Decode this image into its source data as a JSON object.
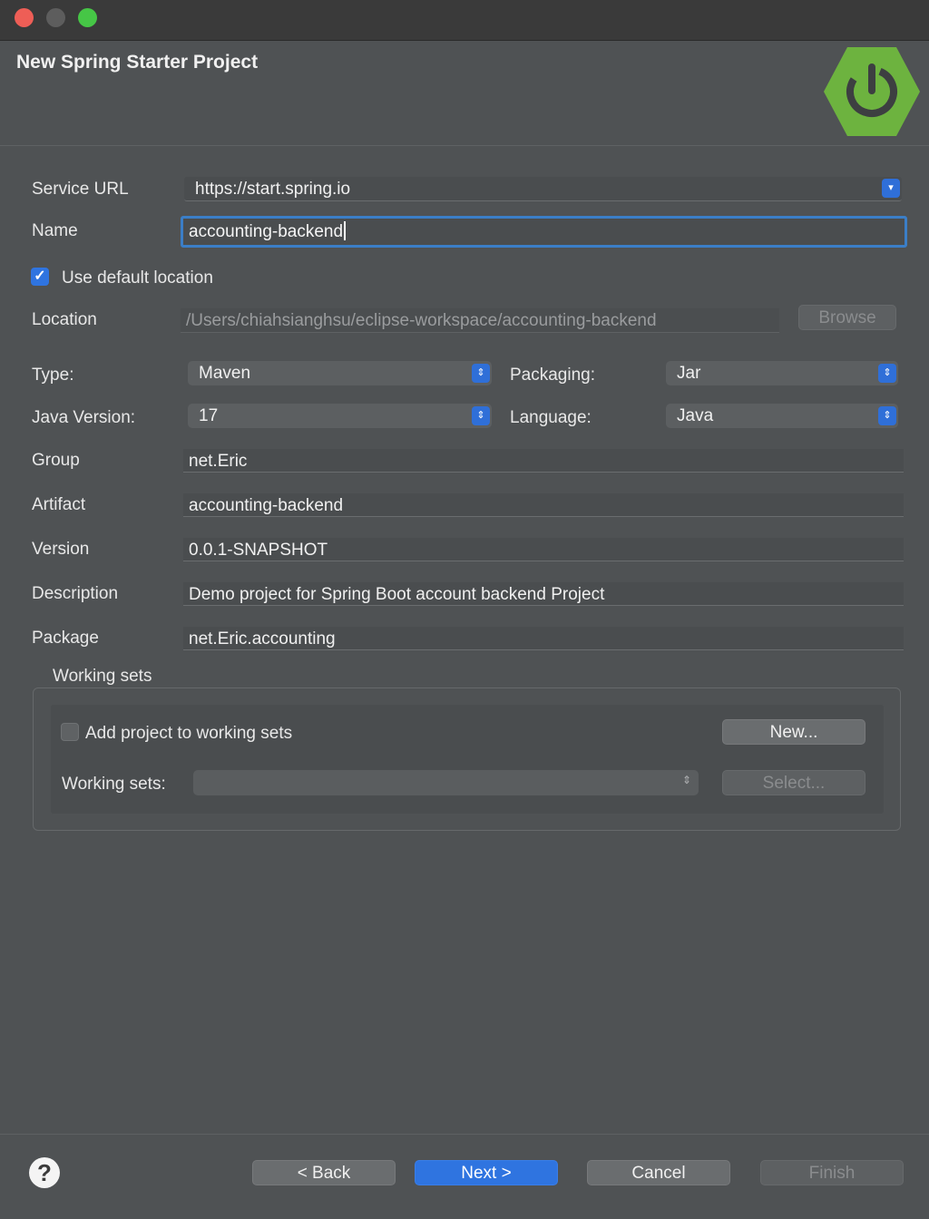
{
  "window": {
    "title": "New Spring Starter Project"
  },
  "form": {
    "service_url": {
      "label": "Service URL",
      "value": "https://start.spring.io"
    },
    "name": {
      "label": "Name",
      "value": "accounting-backend"
    },
    "use_default_location": {
      "label": "Use default location",
      "checked": true
    },
    "location": {
      "label": "Location",
      "value": "/Users/chiahsianghsu/eclipse-workspace/accounting-backend",
      "browse_label": "Browse"
    },
    "type": {
      "label": "Type:",
      "value": "Maven"
    },
    "packaging": {
      "label": "Packaging:",
      "value": "Jar"
    },
    "java_version": {
      "label": "Java Version:",
      "value": "17"
    },
    "language": {
      "label": "Language:",
      "value": "Java"
    },
    "group": {
      "label": "Group",
      "value": "net.Eric"
    },
    "artifact": {
      "label": "Artifact",
      "value": "accounting-backend"
    },
    "version": {
      "label": "Version",
      "value": "0.0.1-SNAPSHOT"
    },
    "description": {
      "label": "Description",
      "value": "Demo project for Spring Boot account backend Project"
    },
    "package": {
      "label": "Package",
      "value": "net.Eric.accounting"
    }
  },
  "working_sets": {
    "group_label": "Working sets",
    "add_label": "Add project to working sets",
    "add_checked": false,
    "new_label": "New...",
    "sets_label": "Working sets:",
    "select_label": "Select..."
  },
  "footer": {
    "help_icon": "?",
    "back_label": "< Back",
    "next_label": "Next >",
    "cancel_label": "Cancel",
    "finish_label": "Finish"
  },
  "colors": {
    "accent": "#2f74e0",
    "spring_green": "#6db33f",
    "window_bg": "#4f5254"
  }
}
